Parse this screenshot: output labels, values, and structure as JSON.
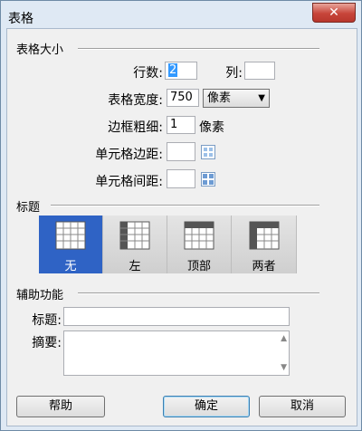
{
  "window": {
    "title": "表格"
  },
  "size_section": {
    "label": "表格大小",
    "rows_label": "行数:",
    "rows_value": "2",
    "cols_label": "列:",
    "cols_value": "",
    "width_label": "表格宽度:",
    "width_value": "750",
    "width_unit": "像素",
    "border_label": "边框粗细:",
    "border_value": "1",
    "border_unit": "像素",
    "padding_label": "单元格边距:",
    "padding_value": "",
    "spacing_label": "单元格间距:",
    "spacing_value": ""
  },
  "header_section": {
    "label": "标题",
    "options": [
      {
        "label": "无",
        "selected": true
      },
      {
        "label": "左",
        "selected": false
      },
      {
        "label": "顶部",
        "selected": false
      },
      {
        "label": "两者",
        "selected": false
      }
    ]
  },
  "accessibility": {
    "label": "辅助功能",
    "caption_label": "标题:",
    "caption_value": "",
    "summary_label": "摘要:",
    "summary_value": ""
  },
  "buttons": {
    "help": "帮助",
    "ok": "确定",
    "cancel": "取消"
  },
  "colors": {
    "selected": "#2f63c5",
    "titlebar": "#dfe9f4",
    "close": "#c7453a"
  }
}
